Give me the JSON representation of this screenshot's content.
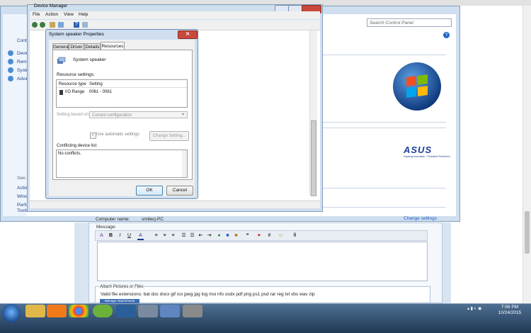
{
  "browser": {
    "url_fragment": "#post3166503"
  },
  "control_panel": {
    "search_placeholder": "Search Control Panel",
    "sidebar_items": [
      "Cont",
      "Devic",
      "Remo",
      "Syste",
      "Adva"
    ],
    "sidebar_bottom_items": [
      "See a",
      "Actio",
      "Wind",
      "Perfo",
      "Tools"
    ],
    "computer_name_label": "Computer name:",
    "computer_name_value": "smilecj-PC",
    "change_settings": "Change settings",
    "brand": "ASUS",
    "brand_tagline": "Inspiring Innovation · Persistent Perfection"
  },
  "device_manager": {
    "title": "Device Manager",
    "menu": [
      "File",
      "Action",
      "View",
      "Help"
    ]
  },
  "properties": {
    "title": "System speaker Properties",
    "tabs": [
      "General",
      "Driver",
      "Details",
      "Resources"
    ],
    "active_tab": "Resources",
    "device_name": "System speaker",
    "resource_settings_label": "Resource settings:",
    "table_headers": [
      "Resource type",
      "Setting"
    ],
    "rows": [
      {
        "type": "I/O Range",
        "setting": "0061 - 0061"
      }
    ],
    "setting_based_label": "Setting based on:",
    "setting_based_value": "Current configuration",
    "use_auto_label": "Use automatic settings",
    "use_auto_checked": true,
    "change_setting_button": "Change Setting...",
    "conflicting_label": "Conflicting device list:",
    "conflicting_value": "No conflicts.",
    "ok_button": "OK",
    "cancel_button": "Cancel"
  },
  "forum": {
    "message_label": "Message:",
    "attach_title": "Attach Pictures or Files",
    "valid_extensions": "Valid file extensions: bat doc docx gif ico jpeg jpg log msi nfo osdx pdf png ps1 psd rar reg txt vbs wav zip",
    "manage_attachments": "Manage Attachments"
  },
  "taskbar": {
    "time": "7:56 PM",
    "date": "10/24/2015"
  }
}
